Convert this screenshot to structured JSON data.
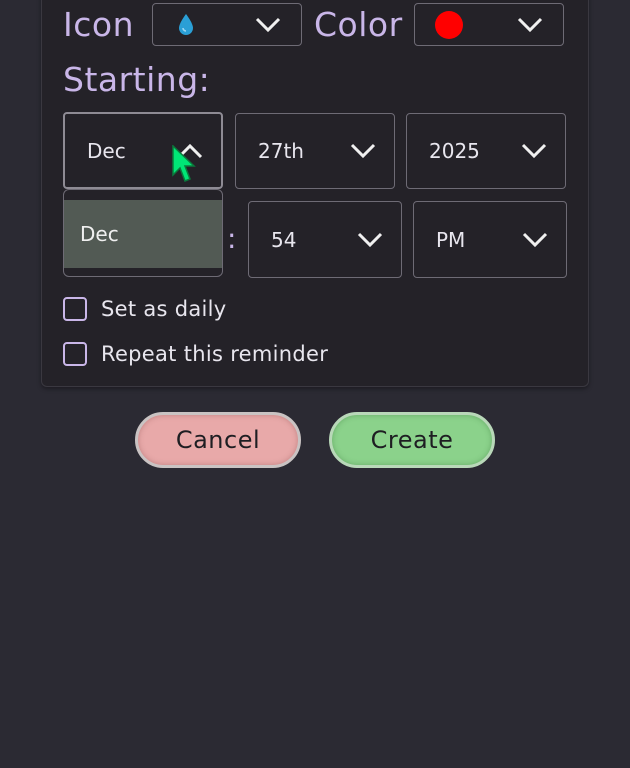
{
  "form": {
    "icon_label": "Icon",
    "icon_value": "droplet-icon",
    "color_label": "Color",
    "color_value": "#ff0000",
    "starting_label": "Starting:",
    "month": "Dec",
    "day": "27th",
    "year": "2025",
    "minute": "54",
    "ampm": "PM",
    "time_separator": ":",
    "month_dropdown_option": "Dec",
    "set_daily_label": "Set as daily",
    "repeat_label": "Repeat this reminder"
  },
  "buttons": {
    "cancel": "Cancel",
    "create": "Create"
  },
  "colors": {
    "accent_purple": "#c9b6e8",
    "cancel_bg": "#e8a9a9",
    "create_bg": "#8bd28b",
    "cursor": "#00e676"
  }
}
